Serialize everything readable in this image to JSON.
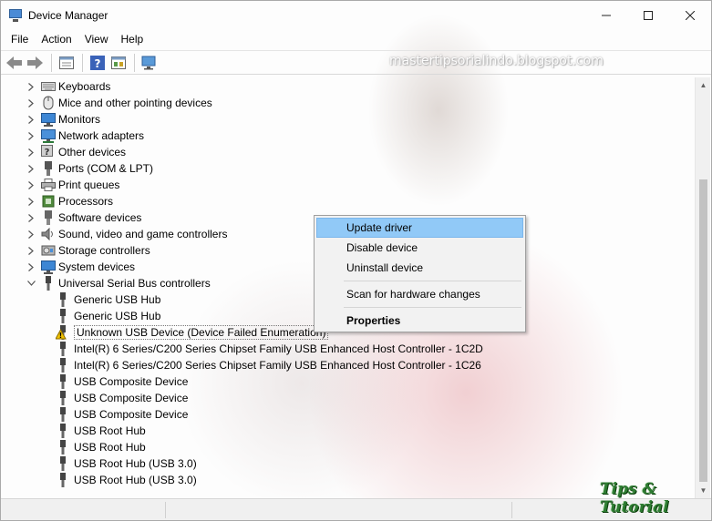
{
  "window": {
    "title": "Device Manager",
    "controls": {
      "minimize": "—",
      "maximize": "☐",
      "close": "✕"
    }
  },
  "menubar": {
    "items": [
      {
        "label": "File"
      },
      {
        "label": "Action"
      },
      {
        "label": "View"
      },
      {
        "label": "Help"
      }
    ]
  },
  "toolbar": {
    "buttons": [
      "back-icon",
      "forward-icon",
      "properties-icon",
      "help-icon",
      "show-hidden-icon",
      "scan-hardware-icon"
    ]
  },
  "watermark": "mastertipsorialindo.blogspot.com",
  "tree": {
    "categories": [
      {
        "label": "Keyboards",
        "icon": "keyboard-icon",
        "expanded": false
      },
      {
        "label": "Mice and other pointing devices",
        "icon": "mouse-icon",
        "expanded": false
      },
      {
        "label": "Monitors",
        "icon": "monitor-icon",
        "expanded": false
      },
      {
        "label": "Network adapters",
        "icon": "network-icon",
        "expanded": false
      },
      {
        "label": "Other devices",
        "icon": "other-devices-icon",
        "expanded": false
      },
      {
        "label": "Ports (COM & LPT)",
        "icon": "port-icon",
        "expanded": false
      },
      {
        "label": "Print queues",
        "icon": "printer-icon",
        "expanded": false
      },
      {
        "label": "Processors",
        "icon": "processor-icon",
        "expanded": false
      },
      {
        "label": "Software devices",
        "icon": "software-device-icon",
        "expanded": false
      },
      {
        "label": "Sound, video and game controllers",
        "icon": "speaker-icon",
        "expanded": false
      },
      {
        "label": "Storage controllers",
        "icon": "storage-icon",
        "expanded": false
      },
      {
        "label": "System devices",
        "icon": "system-icon",
        "expanded": false
      },
      {
        "label": "Universal Serial Bus controllers",
        "icon": "usb-icon",
        "expanded": true
      }
    ],
    "usb_children": [
      {
        "label": "Generic USB Hub",
        "warning": false
      },
      {
        "label": "Generic USB Hub",
        "warning": false
      },
      {
        "label": "Unknown USB Device (Device Failed Enumeration)",
        "warning": true
      },
      {
        "label": "Intel(R) 6 Series/C200 Series Chipset Family USB Enhanced Host Controller - 1C2D",
        "warning": false
      },
      {
        "label": "Intel(R) 6 Series/C200 Series Chipset Family USB Enhanced Host Controller - 1C26",
        "warning": false
      },
      {
        "label": "USB Composite Device",
        "warning": false
      },
      {
        "label": "USB Composite Device",
        "warning": false
      },
      {
        "label": "USB Composite Device",
        "warning": false
      },
      {
        "label": "USB Root Hub",
        "warning": false
      },
      {
        "label": "USB Root Hub",
        "warning": false
      },
      {
        "label": "USB Root Hub (USB 3.0)",
        "warning": false
      },
      {
        "label": "USB Root Hub (USB 3.0)",
        "warning": false
      }
    ]
  },
  "context_menu": {
    "items": [
      {
        "label": "Update driver"
      },
      {
        "label": "Disable device"
      },
      {
        "label": "Uninstall device"
      },
      {
        "label": "Scan for hardware changes"
      },
      {
        "label": "Properties"
      }
    ]
  },
  "logo_text": "Tips & Tutorial",
  "colors": {
    "menu_highlight": "#91c9f7",
    "warning": "#f2c200",
    "logo_green": "#2e7d32"
  }
}
